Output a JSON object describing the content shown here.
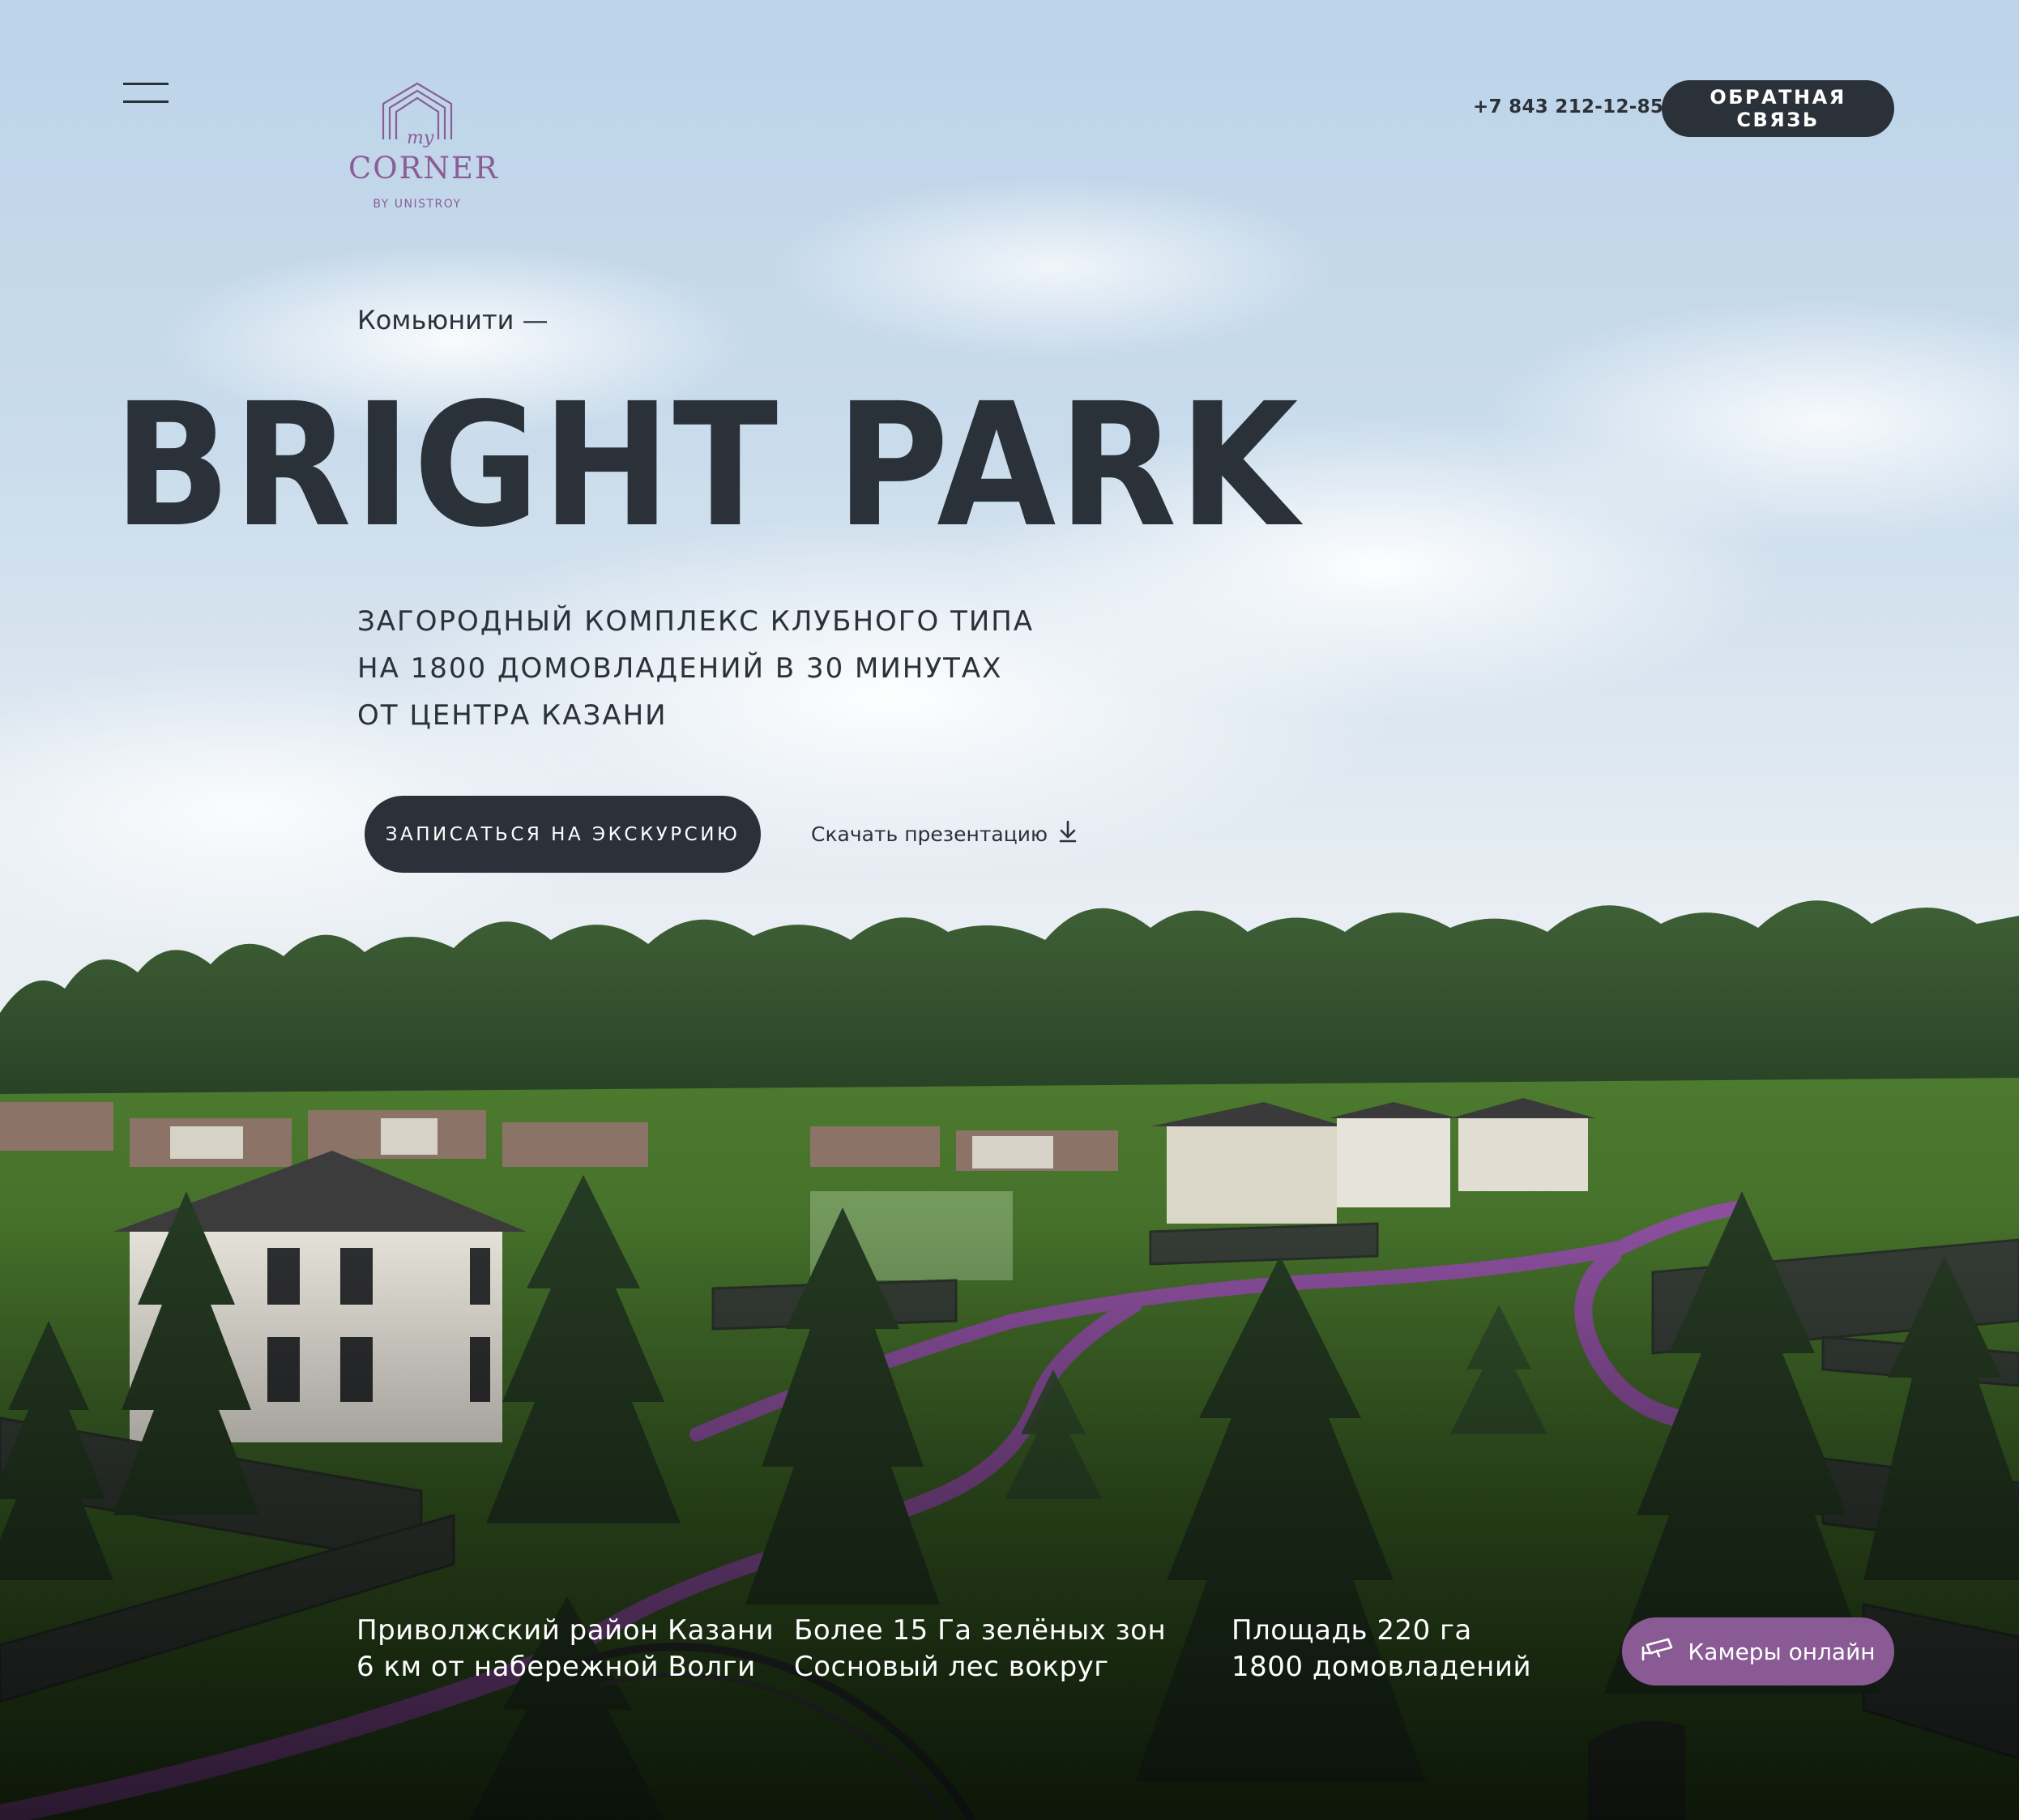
{
  "header": {
    "menu_icon": "hamburger-menu-icon",
    "logo": {
      "script": "my",
      "name": "CORNER",
      "by": "BY UNISTROY",
      "color": "#8a5d96"
    },
    "phone": "+7 843 212-12-85",
    "feedback_label": "ОБРАТНАЯ СВЯЗЬ"
  },
  "hero": {
    "eyebrow": "Комьюнити —",
    "title": "BRIGHT PARK",
    "subtitle_lines": [
      "ЗАГОРОДНЫЙ КОМПЛЕКС КЛУБНОГО ТИПА",
      "НА 1800 ДОМОВЛАДЕНИЙ В 30 МИНУТАХ",
      "ОТ ЦЕНТРА КАЗАНИ"
    ],
    "tour_button": "ЗАПИСАТЬСЯ НА ЭКСКУРСИЮ",
    "download_link": "Скачать презентацию",
    "download_icon": "download-arrow-icon"
  },
  "facts": [
    {
      "line1": "Приволжский район Казани",
      "line2": "6 км от набережной Волги"
    },
    {
      "line1": "Более 15 Га зелёных зон",
      "line2": "Сосновый лес вокруг"
    },
    {
      "line1": "Площадь 220 га",
      "line2": "1800 домовладений"
    }
  ],
  "cameras": {
    "label": "Камеры онлайн",
    "icon": "security-camera-icon"
  },
  "colors": {
    "dark": "#2b3139",
    "accent": "#8a5a95",
    "path": "#8c4f9e"
  }
}
